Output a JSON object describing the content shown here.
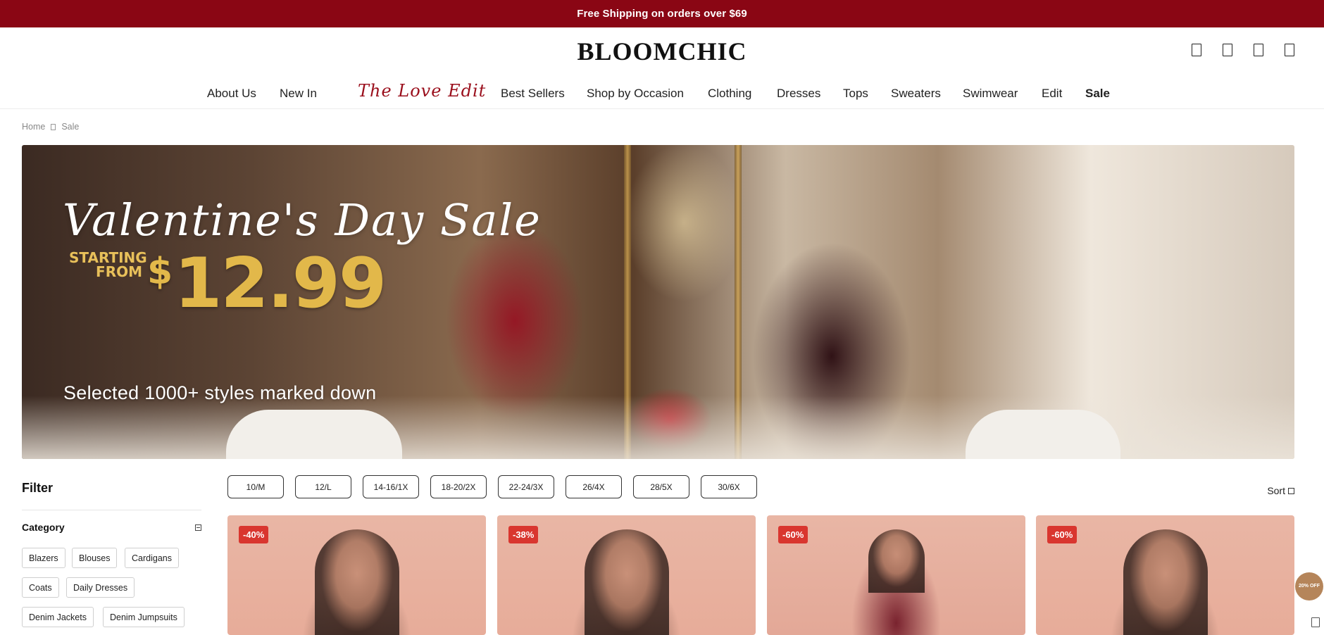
{
  "promo": {
    "text": "Free Shipping on orders over $69"
  },
  "brand": {
    "logo": "BLOOMCHIC"
  },
  "header_icons": [
    "search-icon",
    "account-icon",
    "wishlist-icon",
    "bag-icon"
  ],
  "nav": {
    "about": "About Us",
    "new_in": "New In",
    "love_edit": "The Love Edit",
    "best_sellers": "Best Sellers",
    "occasion": "Shop by Occasion",
    "clothing": "Clothing",
    "dresses": "Dresses",
    "tops": "Tops",
    "sweaters": "Sweaters",
    "swimwear": "Swimwear",
    "edit": "Edit",
    "sale": "Sale"
  },
  "breadcrumb": {
    "home": "Home",
    "current": "Sale"
  },
  "hero": {
    "title": "Valentine's Day Sale",
    "starting_line1": "STARTING",
    "starting_line2": "FROM",
    "currency": "$",
    "price": "12.99",
    "subtitle": "Selected 1000+ styles marked down"
  },
  "filter": {
    "title": "Filter",
    "category_label": "Category",
    "chips": [
      "Blazers",
      "Blouses",
      "Cardigans",
      "Coats",
      "Daily Dresses",
      "Denim Jackets",
      "Denim Jumpsuits"
    ]
  },
  "sizes": [
    "10/M",
    "12/L",
    "14-16/1X",
    "18-20/2X",
    "22-24/3X",
    "26/4X",
    "28/5X",
    "30/6X"
  ],
  "sort": {
    "label": "Sort"
  },
  "products": [
    {
      "discount": "-40%"
    },
    {
      "discount": "-38%"
    },
    {
      "discount": "-60%"
    },
    {
      "discount": "-60%"
    }
  ],
  "coupon": {
    "text": "20% OFF"
  },
  "colors": {
    "promo_bg": "#8a0614",
    "love_edit": "#9a0f1c",
    "badge": "#d9362f",
    "price_gold": "#e2b84a"
  }
}
